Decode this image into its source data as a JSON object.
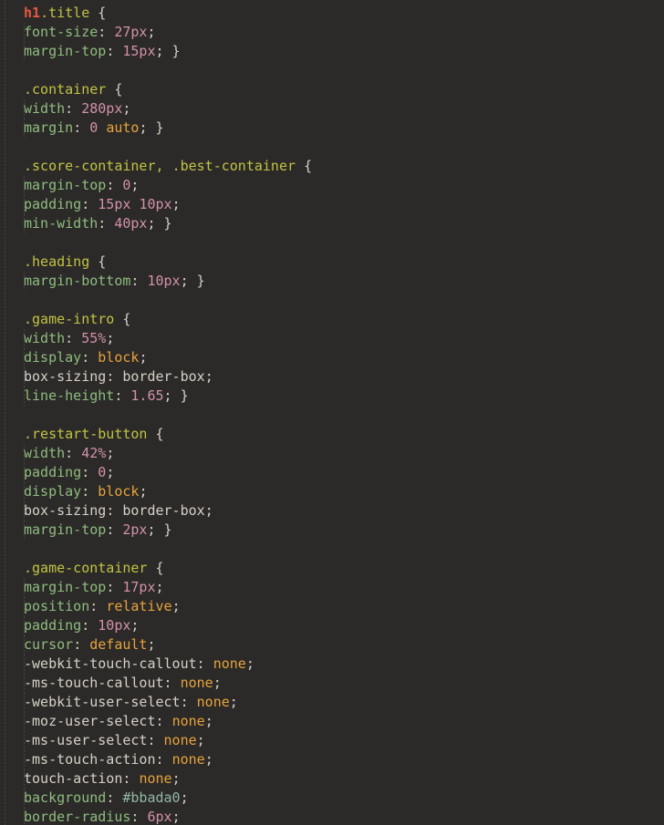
{
  "editor": {
    "language": "css",
    "background_color": "#2b2a28",
    "colors": {
      "element_selector": "#e8573f",
      "class_selector": "#c3c344",
      "property": "#8fbc7f",
      "unknown_property": "#d6d1c7",
      "number": "#d391ab",
      "keyword": "#e8a33d",
      "hex_color": "#93b8a6",
      "punctuation": "#d6d1c7"
    },
    "lines": [
      {
        "indent": false,
        "tokens": [
          {
            "t": "h1",
            "c": "t-elem"
          },
          {
            "t": ".title",
            "c": "t-sel"
          },
          {
            "t": " ",
            "c": "t-plain"
          },
          {
            "t": "{",
            "c": "t-punc"
          }
        ]
      },
      {
        "indent": true,
        "tokens": [
          {
            "t": "font-size",
            "c": "t-prop"
          },
          {
            "t": ": ",
            "c": "t-punc"
          },
          {
            "t": "27px",
            "c": "t-num"
          },
          {
            "t": ";",
            "c": "t-punc"
          }
        ]
      },
      {
        "indent": true,
        "tokens": [
          {
            "t": "margin-top",
            "c": "t-prop"
          },
          {
            "t": ": ",
            "c": "t-punc"
          },
          {
            "t": "15px",
            "c": "t-num"
          },
          {
            "t": "; }",
            "c": "t-punc"
          }
        ]
      },
      {
        "indent": false,
        "tokens": []
      },
      {
        "indent": false,
        "tokens": [
          {
            "t": ".container",
            "c": "t-sel"
          },
          {
            "t": " ",
            "c": "t-plain"
          },
          {
            "t": "{",
            "c": "t-punc"
          }
        ]
      },
      {
        "indent": true,
        "tokens": [
          {
            "t": "width",
            "c": "t-prop"
          },
          {
            "t": ": ",
            "c": "t-punc"
          },
          {
            "t": "280px",
            "c": "t-num"
          },
          {
            "t": ";",
            "c": "t-punc"
          }
        ]
      },
      {
        "indent": true,
        "tokens": [
          {
            "t": "margin",
            "c": "t-prop"
          },
          {
            "t": ": ",
            "c": "t-punc"
          },
          {
            "t": "0",
            "c": "t-num"
          },
          {
            "t": " ",
            "c": "t-plain"
          },
          {
            "t": "auto",
            "c": "t-kw"
          },
          {
            "t": "; }",
            "c": "t-punc"
          }
        ]
      },
      {
        "indent": false,
        "tokens": []
      },
      {
        "indent": false,
        "tokens": [
          {
            "t": ".score-container",
            "c": "t-sel"
          },
          {
            "t": ",",
            "c": "t-sel"
          },
          {
            "t": " ",
            "c": "t-plain"
          },
          {
            "t": ".best-container",
            "c": "t-sel"
          },
          {
            "t": " ",
            "c": "t-plain"
          },
          {
            "t": "{",
            "c": "t-punc"
          }
        ]
      },
      {
        "indent": true,
        "tokens": [
          {
            "t": "margin-top",
            "c": "t-prop"
          },
          {
            "t": ": ",
            "c": "t-punc"
          },
          {
            "t": "0",
            "c": "t-num"
          },
          {
            "t": ";",
            "c": "t-punc"
          }
        ]
      },
      {
        "indent": true,
        "tokens": [
          {
            "t": "padding",
            "c": "t-prop"
          },
          {
            "t": ": ",
            "c": "t-punc"
          },
          {
            "t": "15px",
            "c": "t-num"
          },
          {
            "t": " ",
            "c": "t-plain"
          },
          {
            "t": "10px",
            "c": "t-num"
          },
          {
            "t": ";",
            "c": "t-punc"
          }
        ]
      },
      {
        "indent": true,
        "tokens": [
          {
            "t": "min-width",
            "c": "t-prop"
          },
          {
            "t": ": ",
            "c": "t-punc"
          },
          {
            "t": "40px",
            "c": "t-num"
          },
          {
            "t": "; }",
            "c": "t-punc"
          }
        ]
      },
      {
        "indent": false,
        "tokens": []
      },
      {
        "indent": false,
        "tokens": [
          {
            "t": ".heading",
            "c": "t-sel"
          },
          {
            "t": " ",
            "c": "t-plain"
          },
          {
            "t": "{",
            "c": "t-punc"
          }
        ]
      },
      {
        "indent": true,
        "tokens": [
          {
            "t": "margin-bottom",
            "c": "t-prop"
          },
          {
            "t": ": ",
            "c": "t-punc"
          },
          {
            "t": "10px",
            "c": "t-num"
          },
          {
            "t": "; }",
            "c": "t-punc"
          }
        ]
      },
      {
        "indent": false,
        "tokens": []
      },
      {
        "indent": false,
        "tokens": [
          {
            "t": ".game-intro",
            "c": "t-sel"
          },
          {
            "t": " ",
            "c": "t-plain"
          },
          {
            "t": "{",
            "c": "t-punc"
          }
        ]
      },
      {
        "indent": true,
        "tokens": [
          {
            "t": "width",
            "c": "t-prop"
          },
          {
            "t": ": ",
            "c": "t-punc"
          },
          {
            "t": "55%",
            "c": "t-num"
          },
          {
            "t": ";",
            "c": "t-punc"
          }
        ]
      },
      {
        "indent": true,
        "tokens": [
          {
            "t": "display",
            "c": "t-prop"
          },
          {
            "t": ": ",
            "c": "t-punc"
          },
          {
            "t": "block",
            "c": "t-kw"
          },
          {
            "t": ";",
            "c": "t-punc"
          }
        ]
      },
      {
        "indent": true,
        "tokens": [
          {
            "t": "box-sizing",
            "c": "t-unk"
          },
          {
            "t": ": ",
            "c": "t-punc"
          },
          {
            "t": "border-box",
            "c": "t-unk"
          },
          {
            "t": ";",
            "c": "t-punc"
          }
        ]
      },
      {
        "indent": true,
        "tokens": [
          {
            "t": "line-height",
            "c": "t-prop"
          },
          {
            "t": ": ",
            "c": "t-punc"
          },
          {
            "t": "1.65",
            "c": "t-num"
          },
          {
            "t": "; }",
            "c": "t-punc"
          }
        ]
      },
      {
        "indent": false,
        "tokens": []
      },
      {
        "indent": false,
        "tokens": [
          {
            "t": ".restart-button",
            "c": "t-sel"
          },
          {
            "t": " ",
            "c": "t-plain"
          },
          {
            "t": "{",
            "c": "t-punc"
          }
        ]
      },
      {
        "indent": true,
        "tokens": [
          {
            "t": "width",
            "c": "t-prop"
          },
          {
            "t": ": ",
            "c": "t-punc"
          },
          {
            "t": "42%",
            "c": "t-num"
          },
          {
            "t": ";",
            "c": "t-punc"
          }
        ]
      },
      {
        "indent": true,
        "tokens": [
          {
            "t": "padding",
            "c": "t-prop"
          },
          {
            "t": ": ",
            "c": "t-punc"
          },
          {
            "t": "0",
            "c": "t-num"
          },
          {
            "t": ";",
            "c": "t-punc"
          }
        ]
      },
      {
        "indent": true,
        "tokens": [
          {
            "t": "display",
            "c": "t-prop"
          },
          {
            "t": ": ",
            "c": "t-punc"
          },
          {
            "t": "block",
            "c": "t-kw"
          },
          {
            "t": ";",
            "c": "t-punc"
          }
        ]
      },
      {
        "indent": true,
        "tokens": [
          {
            "t": "box-sizing",
            "c": "t-unk"
          },
          {
            "t": ": ",
            "c": "t-punc"
          },
          {
            "t": "border-box",
            "c": "t-unk"
          },
          {
            "t": ";",
            "c": "t-punc"
          }
        ]
      },
      {
        "indent": true,
        "tokens": [
          {
            "t": "margin-top",
            "c": "t-prop"
          },
          {
            "t": ": ",
            "c": "t-punc"
          },
          {
            "t": "2px",
            "c": "t-num"
          },
          {
            "t": "; }",
            "c": "t-punc"
          }
        ]
      },
      {
        "indent": false,
        "tokens": []
      },
      {
        "indent": false,
        "tokens": [
          {
            "t": ".game-container",
            "c": "t-sel"
          },
          {
            "t": " ",
            "c": "t-plain"
          },
          {
            "t": "{",
            "c": "t-punc"
          }
        ]
      },
      {
        "indent": true,
        "tokens": [
          {
            "t": "margin-top",
            "c": "t-prop"
          },
          {
            "t": ": ",
            "c": "t-punc"
          },
          {
            "t": "17px",
            "c": "t-num"
          },
          {
            "t": ";",
            "c": "t-punc"
          }
        ]
      },
      {
        "indent": true,
        "tokens": [
          {
            "t": "position",
            "c": "t-prop"
          },
          {
            "t": ": ",
            "c": "t-punc"
          },
          {
            "t": "relative",
            "c": "t-kw"
          },
          {
            "t": ";",
            "c": "t-punc"
          }
        ]
      },
      {
        "indent": true,
        "tokens": [
          {
            "t": "padding",
            "c": "t-prop"
          },
          {
            "t": ": ",
            "c": "t-punc"
          },
          {
            "t": "10px",
            "c": "t-num"
          },
          {
            "t": ";",
            "c": "t-punc"
          }
        ]
      },
      {
        "indent": true,
        "tokens": [
          {
            "t": "cursor",
            "c": "t-prop"
          },
          {
            "t": ": ",
            "c": "t-punc"
          },
          {
            "t": "default",
            "c": "t-kw"
          },
          {
            "t": ";",
            "c": "t-punc"
          }
        ]
      },
      {
        "indent": true,
        "tokens": [
          {
            "t": "-webkit-touch-callout",
            "c": "t-unk"
          },
          {
            "t": ": ",
            "c": "t-punc"
          },
          {
            "t": "none",
            "c": "t-kw"
          },
          {
            "t": ";",
            "c": "t-punc"
          }
        ]
      },
      {
        "indent": true,
        "tokens": [
          {
            "t": "-ms-touch-callout",
            "c": "t-unk"
          },
          {
            "t": ": ",
            "c": "t-punc"
          },
          {
            "t": "none",
            "c": "t-kw"
          },
          {
            "t": ";",
            "c": "t-punc"
          }
        ]
      },
      {
        "indent": true,
        "tokens": [
          {
            "t": "-webkit-user-select",
            "c": "t-unk"
          },
          {
            "t": ": ",
            "c": "t-punc"
          },
          {
            "t": "none",
            "c": "t-kw"
          },
          {
            "t": ";",
            "c": "t-punc"
          }
        ]
      },
      {
        "indent": true,
        "tokens": [
          {
            "t": "-moz-user-select",
            "c": "t-unk"
          },
          {
            "t": ": ",
            "c": "t-punc"
          },
          {
            "t": "none",
            "c": "t-kw"
          },
          {
            "t": ";",
            "c": "t-punc"
          }
        ]
      },
      {
        "indent": true,
        "tokens": [
          {
            "t": "-ms-user-select",
            "c": "t-unk"
          },
          {
            "t": ": ",
            "c": "t-punc"
          },
          {
            "t": "none",
            "c": "t-kw"
          },
          {
            "t": ";",
            "c": "t-punc"
          }
        ]
      },
      {
        "indent": true,
        "tokens": [
          {
            "t": "-ms-touch-action",
            "c": "t-unk"
          },
          {
            "t": ": ",
            "c": "t-punc"
          },
          {
            "t": "none",
            "c": "t-kw"
          },
          {
            "t": ";",
            "c": "t-punc"
          }
        ]
      },
      {
        "indent": true,
        "tokens": [
          {
            "t": "touch-action",
            "c": "t-unk"
          },
          {
            "t": ": ",
            "c": "t-punc"
          },
          {
            "t": "none",
            "c": "t-kw"
          },
          {
            "t": ";",
            "c": "t-punc"
          }
        ]
      },
      {
        "indent": true,
        "tokens": [
          {
            "t": "background",
            "c": "t-prop"
          },
          {
            "t": ": ",
            "c": "t-punc"
          },
          {
            "t": "#bbada0",
            "c": "t-hex"
          },
          {
            "t": ";",
            "c": "t-punc"
          }
        ]
      },
      {
        "indent": true,
        "tokens": [
          {
            "t": "border-radius",
            "c": "t-prop"
          },
          {
            "t": ": ",
            "c": "t-punc"
          },
          {
            "t": "6px",
            "c": "t-num"
          },
          {
            "t": ";",
            "c": "t-punc"
          }
        ]
      }
    ]
  }
}
